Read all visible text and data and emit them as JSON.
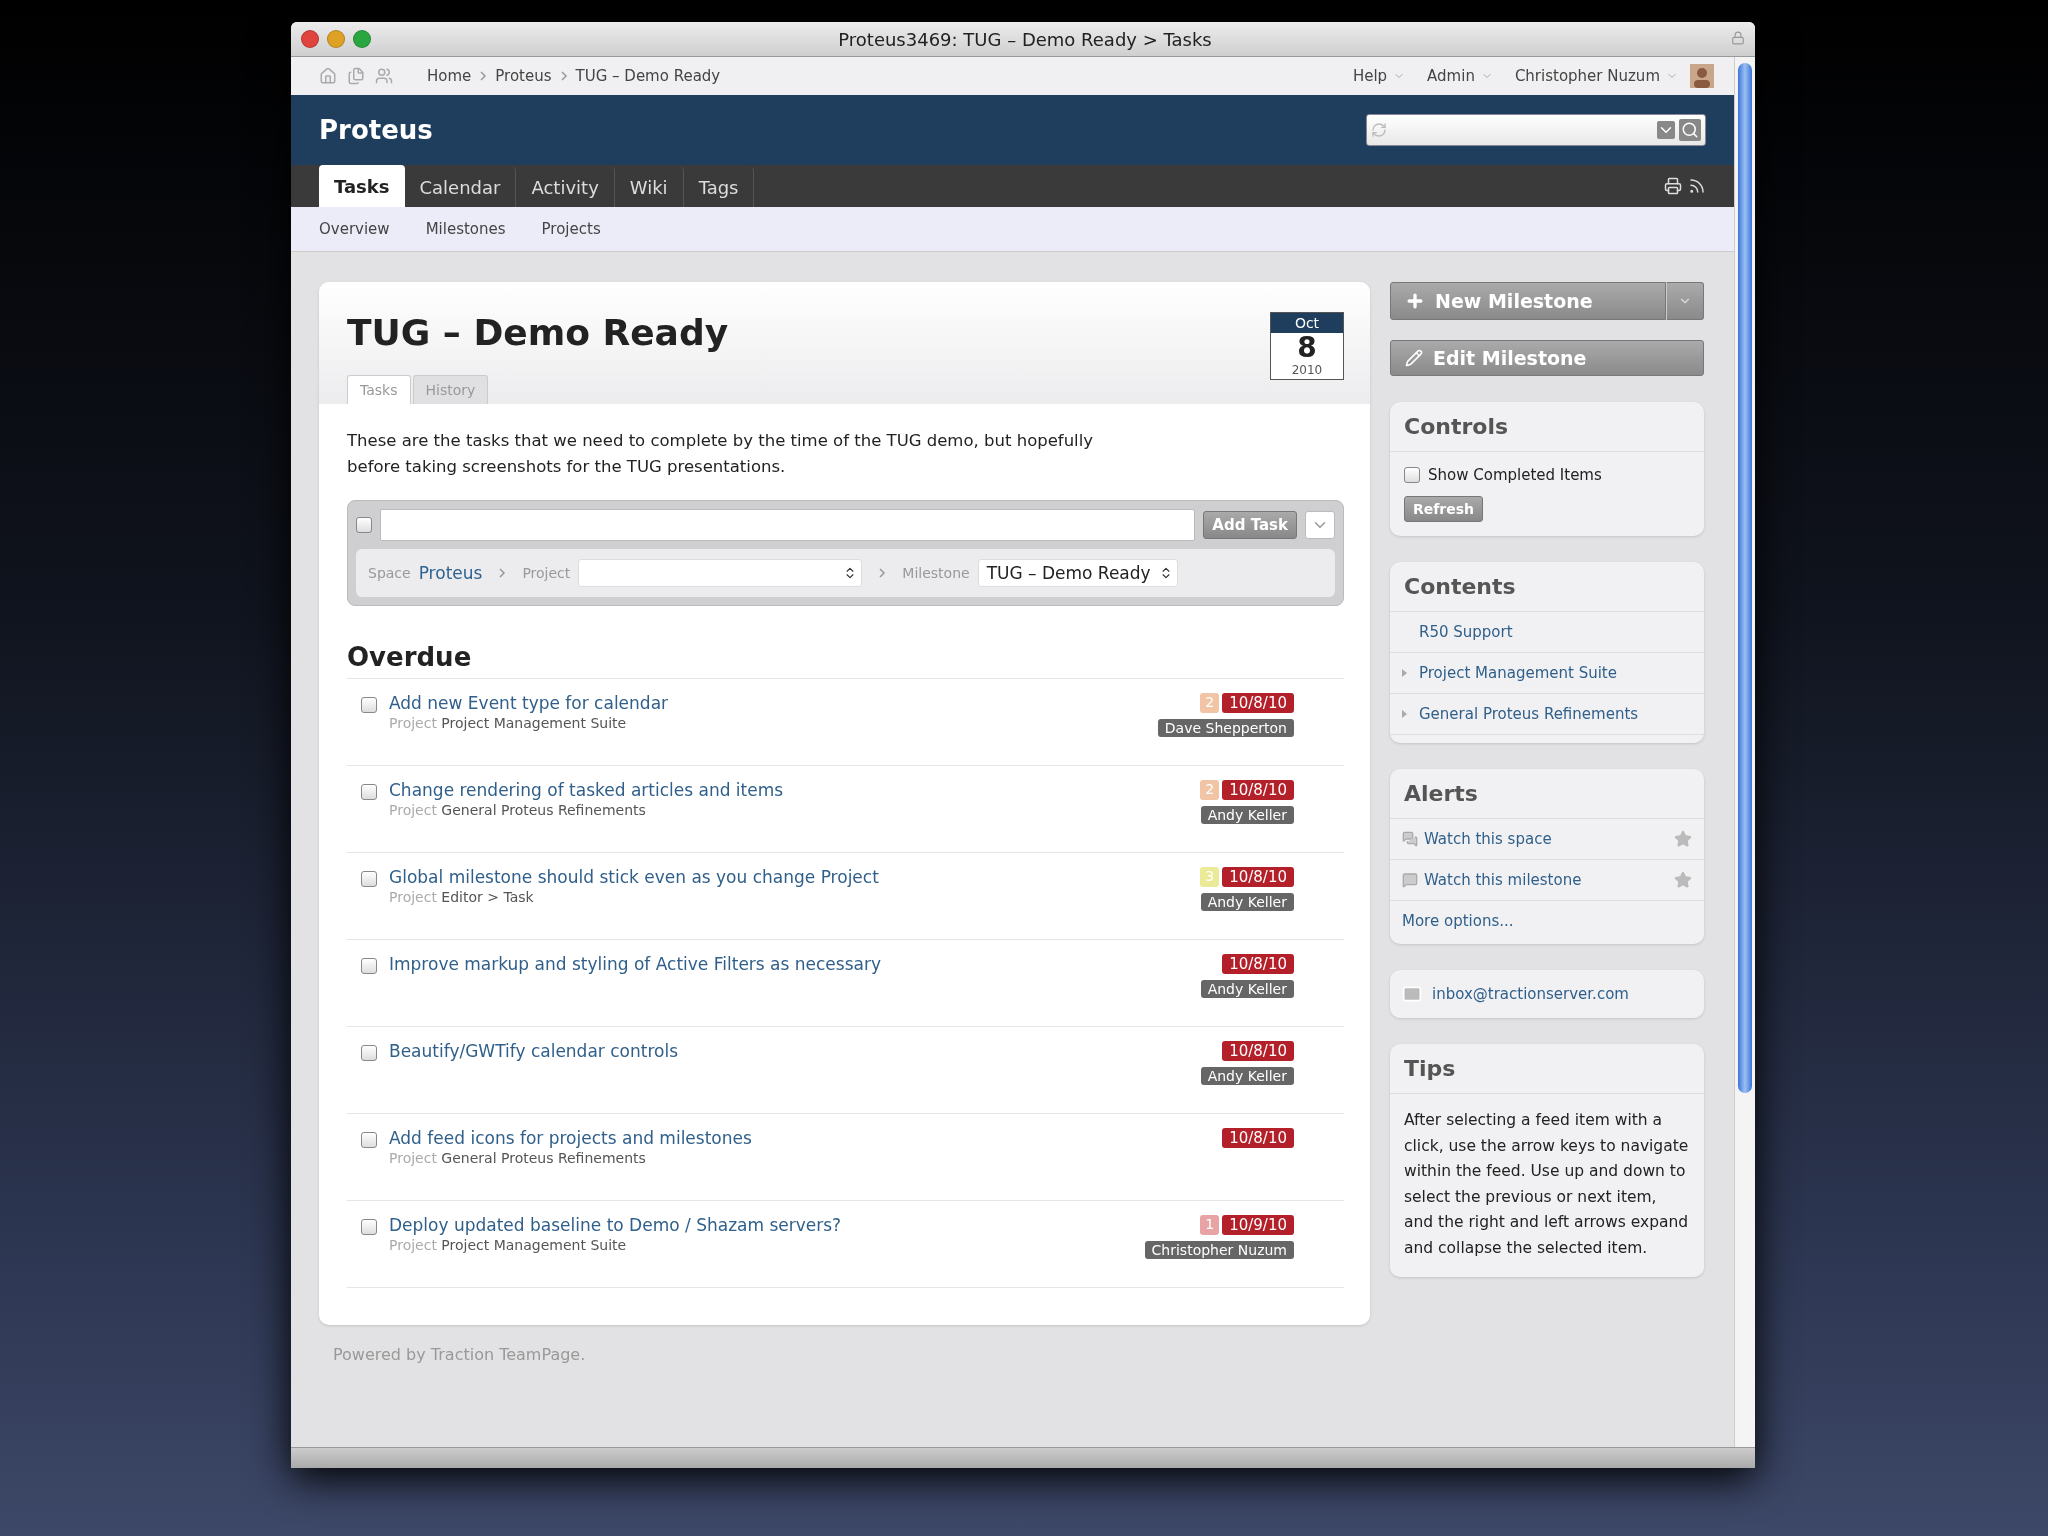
{
  "window": {
    "title": "Proteus3469: TUG – Demo Ready > Tasks"
  },
  "topbar": {
    "breadcrumbs": [
      "Home",
      "Proteus",
      "TUG – Demo Ready"
    ],
    "menus": [
      "Help",
      "Admin",
      "Christopher Nuzum"
    ]
  },
  "header": {
    "space": "Proteus"
  },
  "tabs": [
    {
      "label": "Tasks",
      "selected": true
    },
    {
      "label": "Calendar",
      "selected": false
    },
    {
      "label": "Activity",
      "selected": false
    },
    {
      "label": "Wiki",
      "selected": false
    },
    {
      "label": "Tags",
      "selected": false
    }
  ],
  "subnav": [
    "Overview",
    "Milestones",
    "Projects"
  ],
  "milestone": {
    "title": "TUG – Demo Ready",
    "date": {
      "month": "Oct",
      "day": "8",
      "year": "2010"
    },
    "view_tabs": [
      {
        "label": "Tasks",
        "selected": true
      },
      {
        "label": "History",
        "selected": false
      }
    ],
    "description": "These are the tasks that we need to complete by the time of the TUG demo, but hopefully before taking screenshots for the TUG presentations.",
    "add_task": {
      "checked": false,
      "button": "Add Task",
      "space_label": "Space",
      "space": "Proteus",
      "project_label": "Project",
      "milestone_label": "Milestone",
      "milestone": "TUG – Demo Ready"
    }
  },
  "section": "Overdue",
  "tasks": [
    {
      "title": "Add new Event type for calendar",
      "project_label": "Project",
      "project": "Project Management Suite",
      "priority": "2",
      "color": "#f0c4a4",
      "due": "10/8/10",
      "assignee": "Dave Shepperton",
      "checked": false
    },
    {
      "title": "Change rendering of tasked articles and items",
      "project_label": "Project",
      "project": "General Proteus Refinements",
      "priority": "2",
      "color": "#f0c4a4",
      "due": "10/8/10",
      "assignee": "Andy Keller",
      "checked": false
    },
    {
      "title": "Global milestone should stick even as you change Project",
      "project_label": "Project",
      "project": "Editor > Task",
      "priority": "3",
      "color": "#eaea98",
      "due": "10/8/10",
      "assignee": "Andy Keller",
      "checked": false
    },
    {
      "title": "Improve markup and styling of Active Filters as necessary",
      "due": "10/8/10",
      "assignee": "Andy Keller",
      "checked": false
    },
    {
      "title": "Beautify/GWTify calendar controls",
      "due": "10/8/10",
      "assignee": "Andy Keller",
      "checked": false
    },
    {
      "title": "Add feed icons for projects and milestones",
      "project_label": "Project",
      "project": "General Proteus Refinements",
      "due": "10/8/10",
      "checked": false
    },
    {
      "title": "Deploy updated baseline to Demo / Shazam servers?",
      "project_label": "Project",
      "project": "Project Management Suite",
      "priority": "1",
      "color": "#e8a4a4",
      "due": "10/9/10",
      "assignee": "Christopher Nuzum",
      "checked": false
    }
  ],
  "sidebar": {
    "new_button": "New Milestone",
    "edit_button": "Edit Milestone",
    "controls": {
      "title": "Controls",
      "checkbox": "Show Completed Items",
      "checked": false,
      "refresh": "Refresh"
    },
    "contents": {
      "title": "Contents",
      "items": [
        {
          "label": "R50 Support",
          "expandable": false
        },
        {
          "label": "Project Management Suite",
          "expandable": true
        },
        {
          "label": "General Proteus Refinements",
          "expandable": true
        }
      ]
    },
    "alerts": {
      "title": "Alerts",
      "items": [
        {
          "kind": "space",
          "label": "Watch this space"
        },
        {
          "kind": "milestone",
          "label": "Watch this milestone"
        }
      ],
      "more": "More options..."
    },
    "email": "inbox@tractionserver.com",
    "tips": {
      "title": "Tips",
      "text": "After selecting a feed item with a click, use the arrow keys to navigate within the feed. Use up and down to select the previous or next item, and the right and left arrows expand and collapse the selected item."
    }
  },
  "footer": "Powered by Traction TeamPage."
}
